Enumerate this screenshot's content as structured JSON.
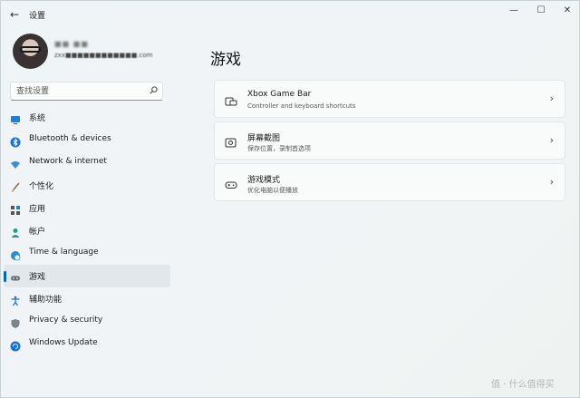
{
  "window": {
    "title": "设置",
    "back_glyph": "←",
    "min_glyph": "—",
    "max_glyph": "☐",
    "close_glyph": "✕"
  },
  "profile": {
    "name": "■■ ■■",
    "email": "zxx■■■■■■■■■■■■.com"
  },
  "search": {
    "placeholder": "查找设置"
  },
  "nav": {
    "items": [
      {
        "label": "系统",
        "icon": "display-icon"
      },
      {
        "label": "Bluetooth & devices",
        "icon": "bluetooth-icon"
      },
      {
        "label": "Network & internet",
        "icon": "wifi-icon"
      },
      {
        "label": "个性化",
        "icon": "brush-icon"
      },
      {
        "label": "应用",
        "icon": "apps-icon"
      },
      {
        "label": "帐户",
        "icon": "person-icon"
      },
      {
        "label": "Time & language",
        "icon": "globe-clock-icon"
      },
      {
        "label": "游戏",
        "icon": "gamepad-icon",
        "selected": true
      },
      {
        "label": "辅助功能",
        "icon": "accessibility-icon"
      },
      {
        "label": "Privacy & security",
        "icon": "shield-icon"
      },
      {
        "label": "Windows Update",
        "icon": "update-icon"
      }
    ]
  },
  "main": {
    "title": "游戏",
    "cards": [
      {
        "title": "Xbox Game Bar",
        "subtitle": "Controller and keyboard shortcuts",
        "icon": "game-bar-icon"
      },
      {
        "title": "屏幕截图",
        "subtitle": "保存位置，录制首选项",
        "icon": "capture-icon"
      },
      {
        "title": "游戏模式",
        "subtitle": "优化电脑以便播放",
        "icon": "game-mode-icon"
      }
    ],
    "chevron": "›"
  },
  "watermark": "值 · 什么值得买",
  "colors": {
    "accent": "#0067c0",
    "selected_bg": "#e1e7ea"
  }
}
